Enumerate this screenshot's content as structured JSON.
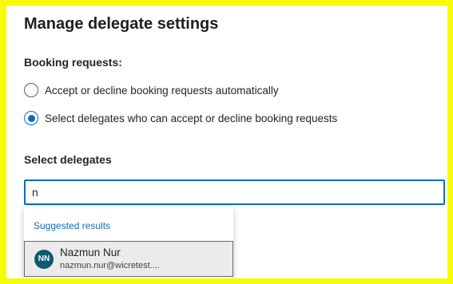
{
  "dialog": {
    "title": "Manage delegate settings",
    "booking_requests_label": "Booking requests:",
    "options": [
      {
        "label": "Accept or decline booking requests automatically",
        "selected": false
      },
      {
        "label": "Select delegates who can accept or decline booking requests",
        "selected": true
      }
    ],
    "select_delegates_label": "Select delegates",
    "search": {
      "value": "n"
    },
    "suggestions": {
      "heading": "Suggested results",
      "items": [
        {
          "initials": "NN",
          "name": "Nazmun Nur",
          "email": "nazmun.nur@wicretest...."
        }
      ]
    }
  },
  "colors": {
    "accent": "#0f6cbd",
    "avatar_bg": "#0e5a6e",
    "frame": "#f7fb04"
  }
}
